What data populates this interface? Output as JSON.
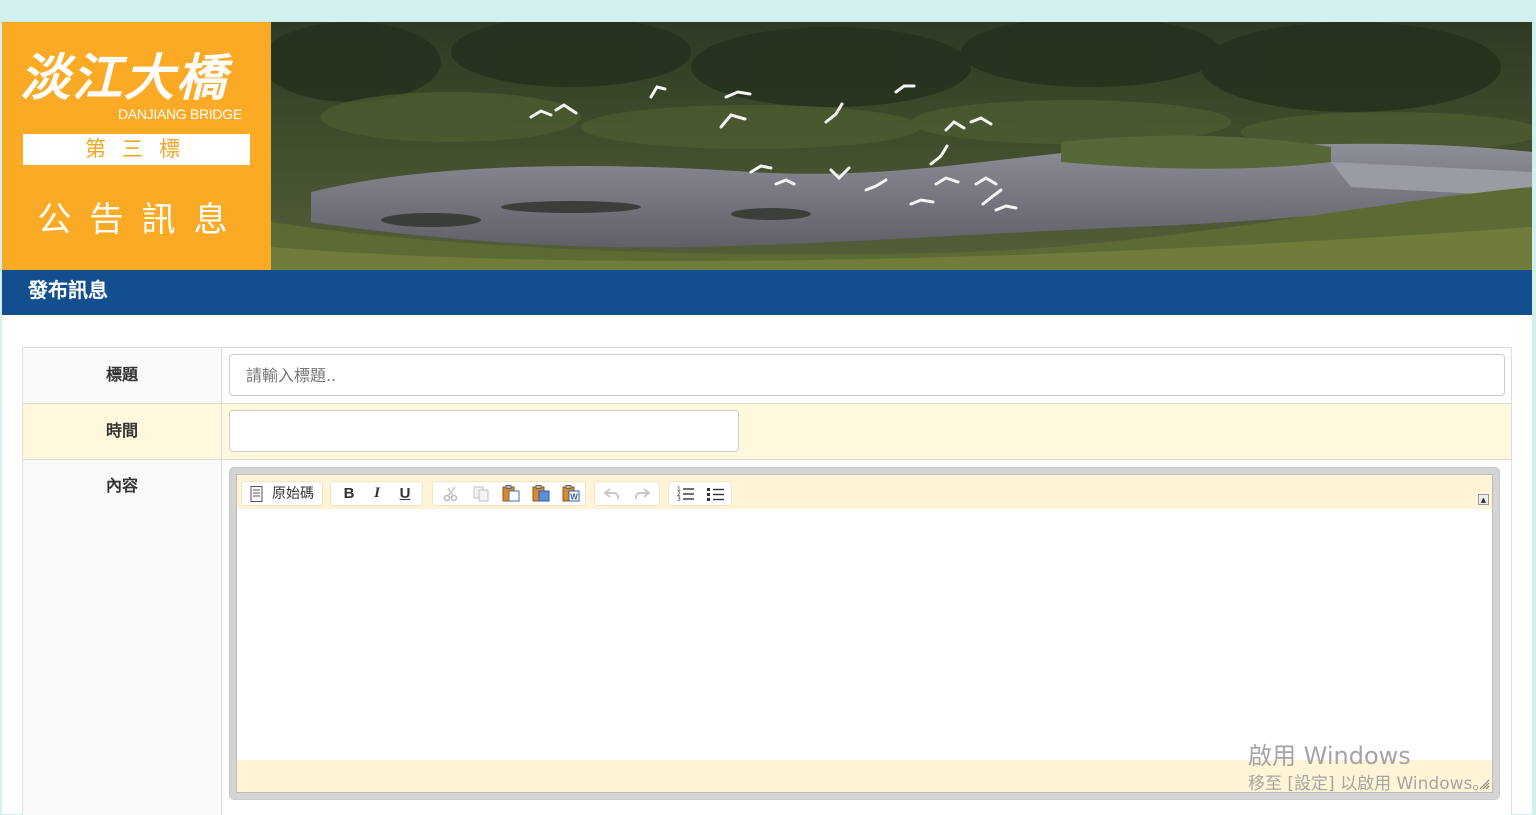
{
  "banner": {
    "logo_title": "淡江大橋",
    "logo_subtitle": "DANJIANG BRIDGE",
    "logo_badge": "第三標",
    "logo_section": "公告訊息"
  },
  "titlebar": {
    "title": "發布訊息"
  },
  "form": {
    "title_label": "標題",
    "title_placeholder": "請輸入標題..",
    "time_label": "時間",
    "time_value": "",
    "content_label": "內容"
  },
  "editor": {
    "source_label": "原始碼",
    "bold_label": "B",
    "italic_label": "I",
    "underline_label": "U",
    "icons": [
      "document-icon",
      "cut-icon",
      "copy-icon",
      "paste-icon",
      "paste-text-icon",
      "paste-word-icon",
      "undo-icon",
      "redo-icon",
      "numbered-list-icon",
      "bulleted-list-icon",
      "collapse-icon",
      "resize-grip-icon"
    ]
  },
  "watermark": {
    "line1": "啟用 Windows",
    "line2": "移至 [設定] 以啟用 Windows。"
  },
  "colors": {
    "page_bg": "#d1f0ee",
    "logo_orange": "#fbaa25",
    "titlebar_blue": "#134f8e",
    "row_highlight": "#fff8dc"
  }
}
